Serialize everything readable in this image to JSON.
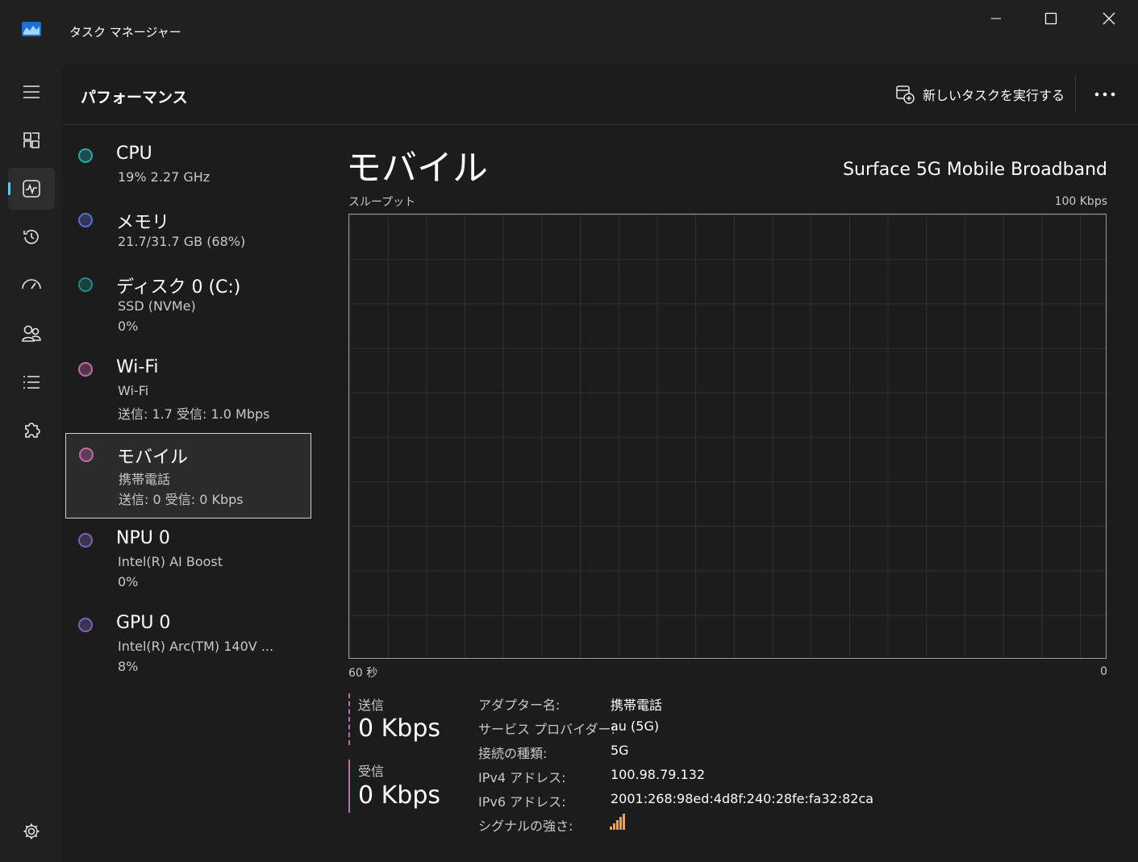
{
  "window": {
    "title": "タスク マネージャー"
  },
  "commandbar": {
    "page_title": "パフォーマンス",
    "run_task_label": "新しいタスクを実行する"
  },
  "devices": [
    {
      "name": "CPU",
      "line1": "19%  2.27 GHz",
      "line2": "",
      "dot_color": "#2aa7b0"
    },
    {
      "name": "メモリ",
      "line1": "21.7/31.7 GB (68%)",
      "line2": "",
      "dot_color": "#5a6fd0"
    },
    {
      "name": "ディスク 0 (C:)",
      "line1": "SSD (NVMe)",
      "line2": "0%",
      "dot_color": "#1f8a8a"
    },
    {
      "name": "Wi-Fi",
      "line1": "Wi-Fi",
      "line2": "送信: 1.7  受信: 1.0 Mbps",
      "dot_color": "#c06cab"
    },
    {
      "name": "モバイル",
      "line1": "携帯電話",
      "line2": "送信: 0  受信: 0 Kbps",
      "dot_color": "#c06cab"
    },
    {
      "name": "NPU 0",
      "line1": "Intel(R) AI Boost",
      "line2": "0%",
      "dot_color": "#7a63b8"
    },
    {
      "name": "GPU 0",
      "line1": "Intel(R) Arc(TM) 140V ...",
      "line2": "8%",
      "dot_color": "#7a63b8"
    }
  ],
  "detail": {
    "title": "モバイル",
    "device_name": "Surface 5G Mobile Broadband",
    "graph_label": "スループット",
    "graph_max": "100 Kbps",
    "graph_time": "60 秒",
    "graph_min": "0",
    "send_label": "送信",
    "send_value": "0 Kbps",
    "recv_label": "受信",
    "recv_value": "0 Kbps",
    "props": [
      {
        "key": "アダプター名:",
        "value": "携帯電話"
      },
      {
        "key": "サービス プロバイダー:",
        "value": "au (5G)"
      },
      {
        "key": "接続の種類:",
        "value": "5G"
      },
      {
        "key": "IPv4 アドレス:",
        "value": "100.98.79.132"
      },
      {
        "key": "IPv6 アドレス:",
        "value": "2001:268:98ed:4d8f:240:28fe:fa32:82ca"
      },
      {
        "key": "シグナルの強さ:",
        "value": ""
      }
    ],
    "signal_bars": 5
  },
  "colors": {
    "accent": "#60cdff",
    "send": "#c06cab",
    "recv": "#c06cab"
  }
}
